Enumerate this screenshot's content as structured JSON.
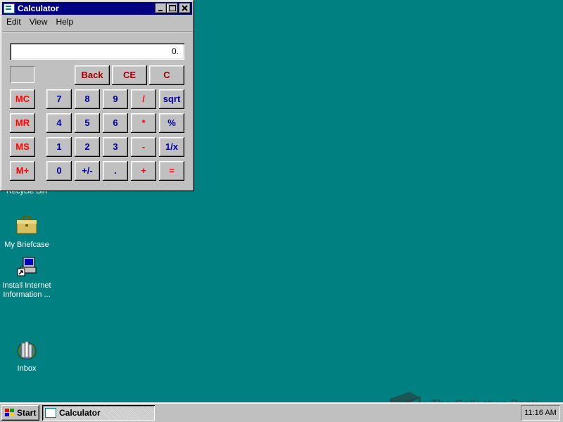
{
  "window": {
    "title": "Calculator",
    "controls": {
      "minimize": "_",
      "maximize": "□",
      "close": "×"
    },
    "menu": [
      "Edit",
      "View",
      "Help"
    ],
    "display_value": "0."
  },
  "buttons": {
    "back": "Back",
    "ce": "CE",
    "c": "C",
    "mc": "MC",
    "mr": "MR",
    "ms": "MS",
    "mplus": "M+",
    "n7": "7",
    "n8": "8",
    "n9": "9",
    "div": "/",
    "sqrt": "sqrt",
    "n4": "4",
    "n5": "5",
    "n6": "6",
    "mul": "*",
    "pct": "%",
    "n1": "1",
    "n2": "2",
    "n3": "3",
    "sub": "-",
    "recip": "1/x",
    "n0": "0",
    "sign": "+/-",
    "dot": ".",
    "add": "+",
    "eq": "="
  },
  "desktop_icons": [
    {
      "label": "Recycle Bin",
      "icon": "recycle-bin-icon"
    },
    {
      "label": "My Briefcase",
      "icon": "briefcase-icon"
    },
    {
      "label": "Install Internet\nInformation ...",
      "icon": "install-icon"
    },
    {
      "label": "Inbox",
      "icon": "inbox-icon"
    }
  ],
  "taskbar": {
    "start_label": "Start",
    "task_label": "Calculator",
    "clock": "11:16 AM"
  },
  "watermark": "The Collection Book",
  "colors": {
    "desktop": "#008080",
    "titlebar": "#000080",
    "red_keys": "#ff0000",
    "blue_keys": "#0000a0"
  }
}
